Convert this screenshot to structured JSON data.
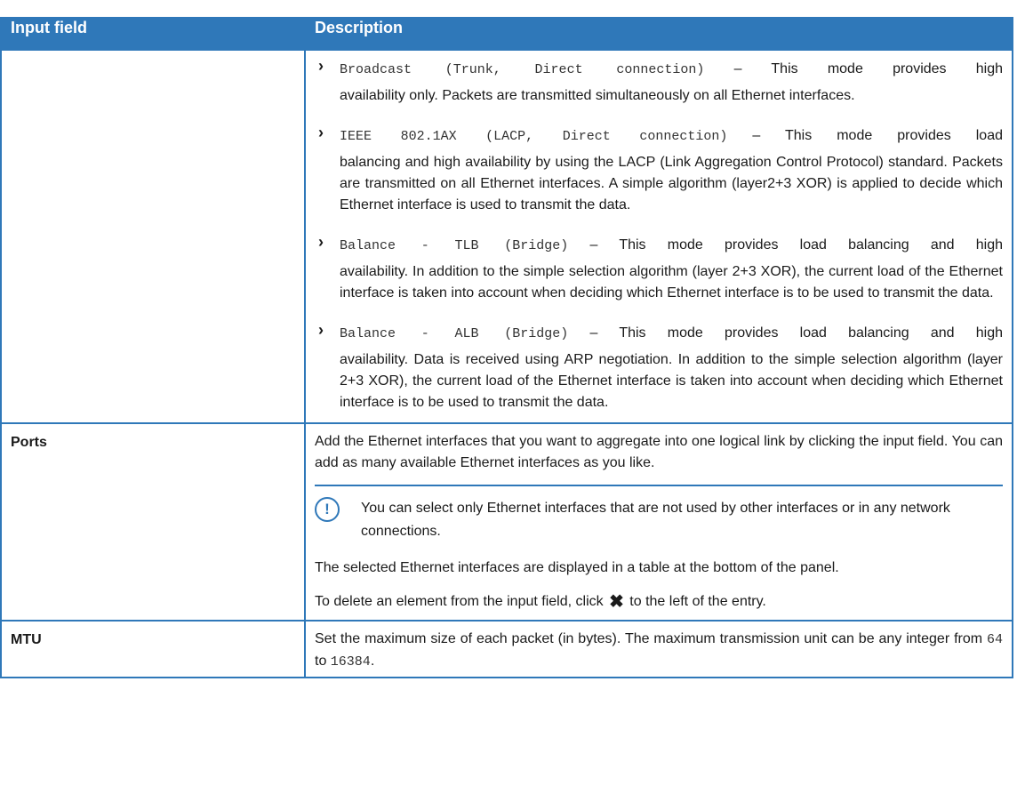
{
  "header": {
    "col1": "Input field",
    "col2": "Description"
  },
  "mode_bullets": [
    {
      "code": "Broadcast (Trunk, Direct connection)",
      "first": " – This mode provides high",
      "rest": "availability only. Packets are transmitted simultaneously on all Ethernet interfaces."
    },
    {
      "code": "IEEE 802.1AX (LACP, Direct connection)",
      "first": " – This mode provides load",
      "rest": "balancing and high availability by using the LACP (Link Aggregation Control Protocol) standard. Packets are transmitted on all Ethernet interfaces. A simple algorithm (layer2+3 XOR) is applied to decide which Ethernet interface is used to transmit the data."
    },
    {
      "code": "Balance - TLB (Bridge)",
      "first": " – This mode provides load balancing and high",
      "rest": "availability. In addition to the simple selection algorithm (layer 2+3 XOR), the current load of the Ethernet interface is taken into account when deciding which Ethernet interface is to be used to transmit the data."
    },
    {
      "code": "Balance - ALB (Bridge)",
      "first": " – This mode provides load balancing and high",
      "rest": "availability. Data is received using ARP negotiation. In addition to the simple selection algorithm (layer 2+3 XOR), the current load of the Ethernet interface is taken into account when deciding which Ethernet interface is to be used to transmit the data."
    }
  ],
  "ports": {
    "field": "Ports",
    "desc": "Add the Ethernet interfaces that you want to aggregate into one logical link by clicking the input field. You can add as many available Ethernet interfaces as you like.",
    "note": "You can select only Ethernet interfaces that are not used by other interfaces or in any network connections.",
    "selected": "The selected Ethernet interfaces are displayed in a table at the bottom of the panel.",
    "delete_pre": "To delete an element from the input field, click",
    "delete_post": "to the left of the entry."
  },
  "mtu": {
    "field": "MTU",
    "desc_pre": "Set the maximum size of each packet (in bytes). The maximum transmission unit can be any integer from",
    "min": "64",
    "to": "to",
    "max": "16384",
    "end": "."
  },
  "icons": {
    "bullet": "chevron-right-icon",
    "note": "exclamation-circle-icon",
    "delete": "x-icon",
    "accent": "#2f78b9"
  }
}
